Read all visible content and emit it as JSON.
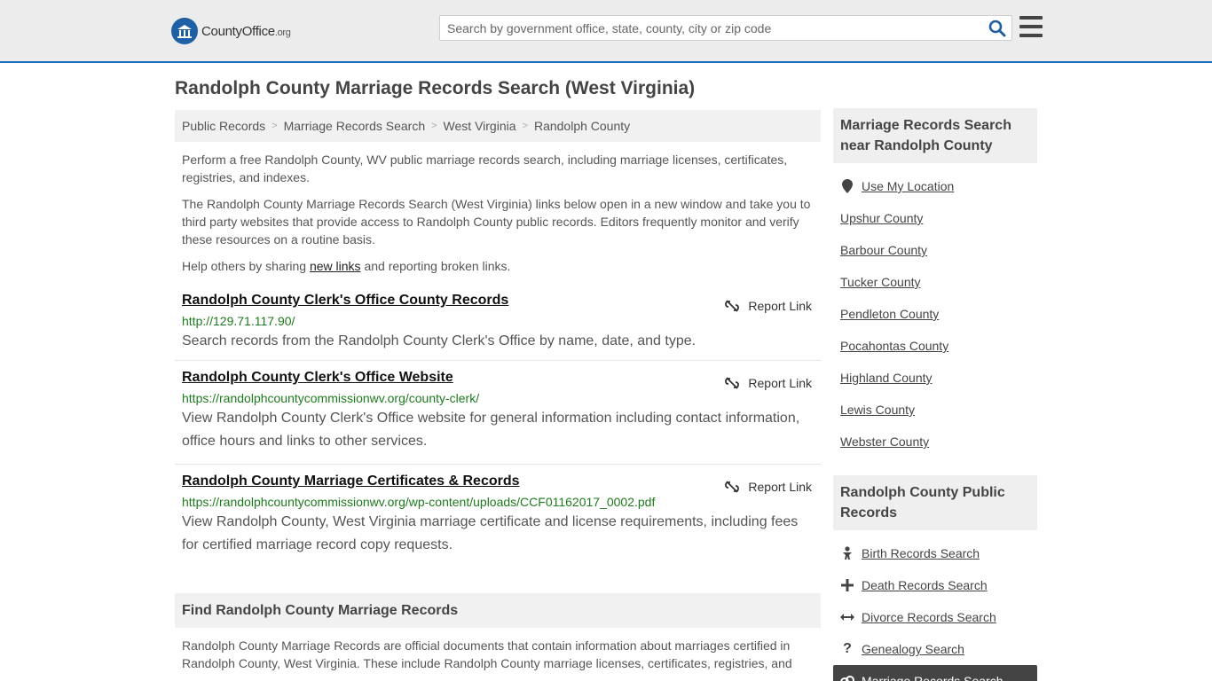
{
  "header": {
    "logo_main": "CountyOffice",
    "logo_suffix": ".org",
    "search_placeholder": "Search by government office, state, county, city or zip code"
  },
  "page_title": "Randolph County Marriage Records Search (West Virginia)",
  "breadcrumb": [
    "Public Records",
    "Marriage Records Search",
    "West Virginia",
    "Randolph County"
  ],
  "intro": {
    "p1": "Perform a free Randolph County, WV public marriage records search, including marriage licenses, certificates, registries, and indexes.",
    "p2": "The Randolph County Marriage Records Search (West Virginia) links below open in a new window and take you to third party websites that provide access to Randolph County public records. Editors frequently monitor and verify these resources on a routine basis.",
    "p3_before": "Help others by sharing ",
    "p3_link": "new links",
    "p3_after": " and reporting broken links."
  },
  "report_label": "Report Link",
  "results": [
    {
      "title": "Randolph County Clerk's Office County Records",
      "url": "http://129.71.117.90/",
      "desc": "Search records from the Randolph County Clerk's Office by name, date, and type."
    },
    {
      "title": "Randolph County Clerk's Office Website",
      "url": "https://randolphcountycommissionwv.org/county-clerk/",
      "desc": "View Randolph County Clerk's Office website for general information including contact information, office hours and links to other services."
    },
    {
      "title": "Randolph County Marriage Certificates & Records",
      "url": "https://randolphcountycommissionwv.org/wp-content/uploads/CCF01162017_0002.pdf",
      "desc": "View Randolph County, West Virginia marriage certificate and license requirements, including fees for certified marriage record copy requests."
    }
  ],
  "find_section": {
    "title": "Find Randolph County Marriage Records",
    "text": "Randolph County Marriage Records are official documents that contain information about marriages certified in Randolph County, West Virginia. These include Randolph County marriage licenses, certificates, registries, and"
  },
  "sidebar": {
    "nearby_title": "Marriage Records Search near Randolph County",
    "use_location": "Use My Location",
    "nearby": [
      "Upshur County",
      "Barbour County",
      "Tucker County",
      "Pendleton County",
      "Pocahontas County",
      "Highland County",
      "Lewis County",
      "Webster County"
    ],
    "public_title": "Randolph County Public Records",
    "public": [
      {
        "label": "Birth Records Search",
        "icon": "baby-icon"
      },
      {
        "label": "Death Records Search",
        "icon": "cross-icon"
      },
      {
        "label": "Divorce Records Search",
        "icon": "arrows-icon"
      },
      {
        "label": "Genealogy Search",
        "icon": "question-icon"
      },
      {
        "label": "Marriage Records Search",
        "icon": "rings-icon"
      }
    ]
  }
}
